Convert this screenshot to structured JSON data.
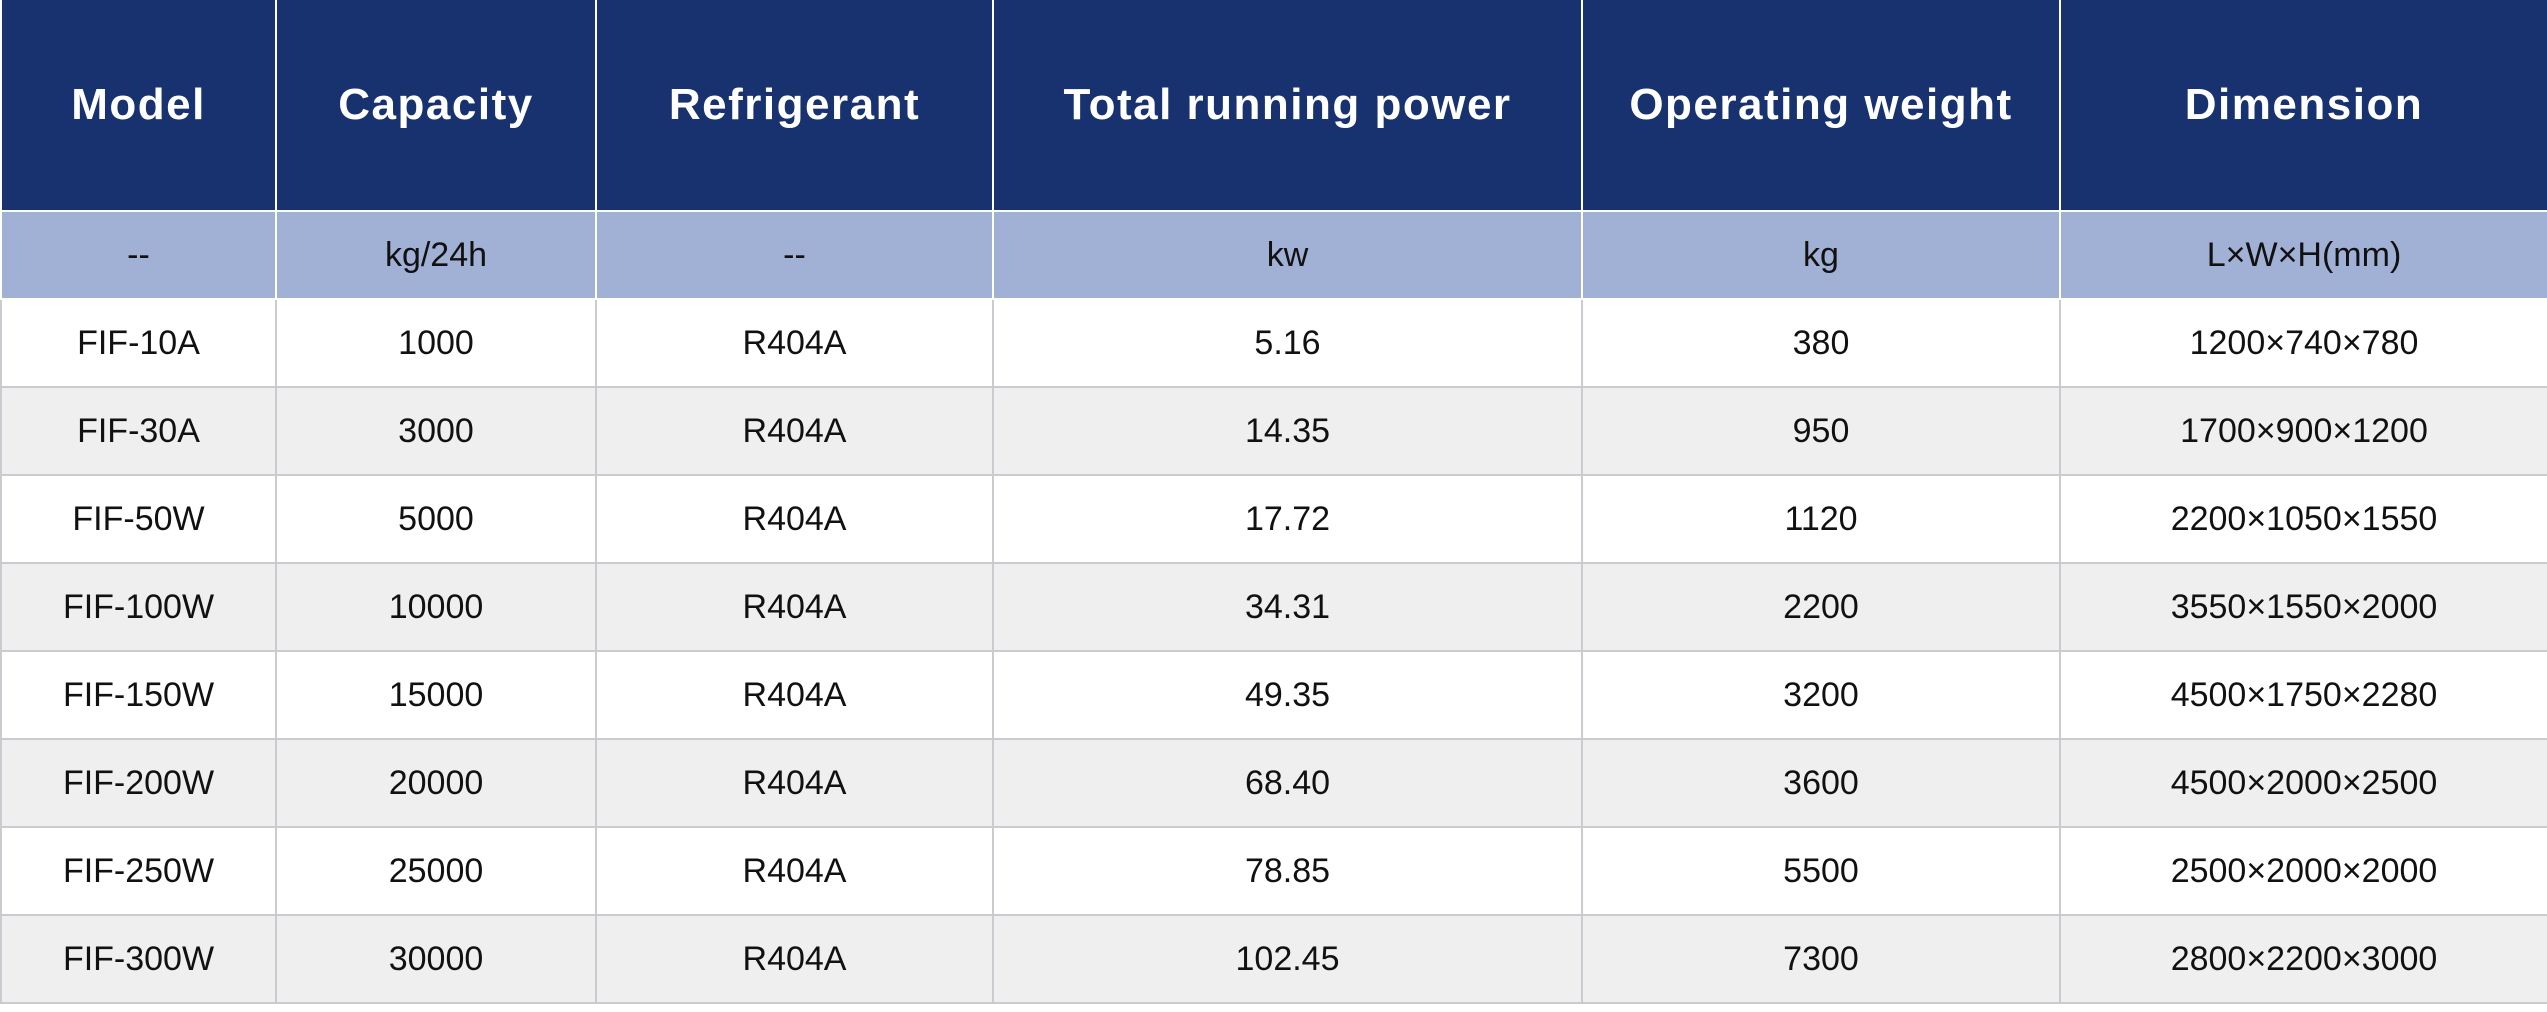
{
  "table": {
    "headers": [
      "Model",
      "Capacity",
      "Refrigerant",
      "Total running power",
      "Operating weight",
      "Dimension"
    ],
    "units": [
      "--",
      "kg/24h",
      "--",
      "kw",
      "kg",
      "L×W×H(mm)"
    ],
    "rows": [
      [
        "FIF-10A",
        "1000",
        "R404A",
        "5.16",
        "380",
        "1200×740×780"
      ],
      [
        "FIF-30A",
        "3000",
        "R404A",
        "14.35",
        "950",
        "1700×900×1200"
      ],
      [
        "FIF-50W",
        "5000",
        "R404A",
        "17.72",
        "1120",
        "2200×1050×1550"
      ],
      [
        "FIF-100W",
        "10000",
        "R404A",
        "34.31",
        "2200",
        "3550×1550×2000"
      ],
      [
        "FIF-150W",
        "15000",
        "R404A",
        "49.35",
        "3200",
        "4500×1750×2280"
      ],
      [
        "FIF-200W",
        "20000",
        "R404A",
        "68.40",
        "3600",
        "4500×2000×2500"
      ],
      [
        "FIF-250W",
        "25000",
        "R404A",
        "78.85",
        "5500",
        "2500×2000×2000"
      ],
      [
        "FIF-300W",
        "30000",
        "R404A",
        "102.45",
        "7300",
        "2800×2200×3000"
      ]
    ]
  },
  "colors": {
    "header_bg": "#17326f",
    "unit_row_bg": "#a1b0d5",
    "stripe_bg": "#efefef"
  }
}
